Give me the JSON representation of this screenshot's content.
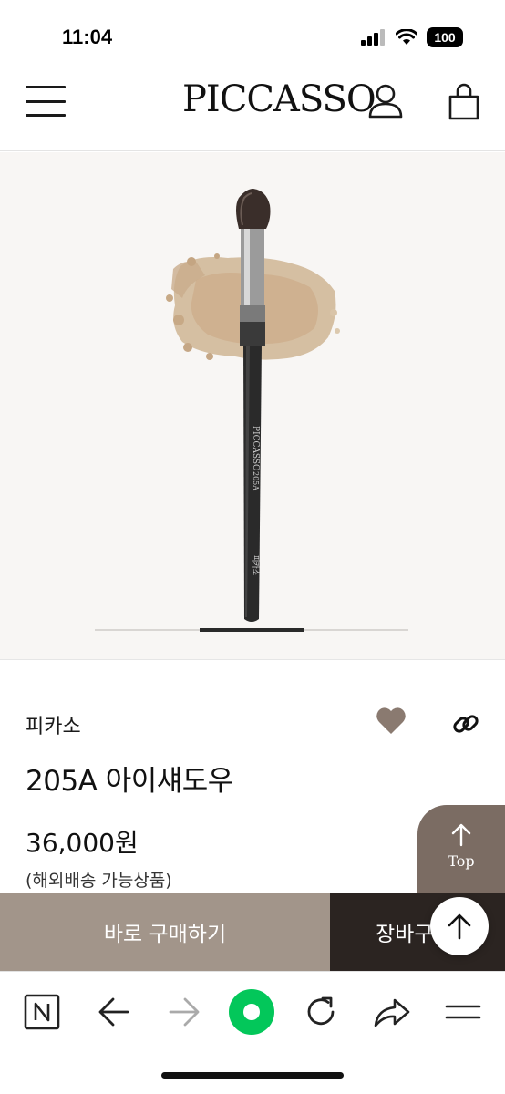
{
  "status_bar": {
    "time": "11:04",
    "battery": "100"
  },
  "header": {
    "logo_text": "PICCASSO"
  },
  "gallery": {
    "image_alt": "205A eyeshadow brush product image",
    "brush_print": [
      "PICCASSO",
      "205A",
      "피카소"
    ]
  },
  "product": {
    "brand": "피카소",
    "name": "205A 아이섀도우",
    "price": "36,000원",
    "shipping_note": "(해외배송 가능상품)"
  },
  "top_tab": {
    "label": "Top"
  },
  "purchase": {
    "buy_now_label": "바로 구매하기",
    "add_cart_label": "장바구니"
  },
  "colors": {
    "accent_taupe": "#a2958a",
    "dark": "#2b2421",
    "tab": "#7b6c63",
    "naver_green": "#03c75a"
  },
  "browser": {
    "icons": [
      "naver-n-icon",
      "back-arrow-icon",
      "forward-arrow-icon",
      "green-home-icon",
      "reload-icon",
      "share-icon",
      "menu-icon"
    ]
  }
}
